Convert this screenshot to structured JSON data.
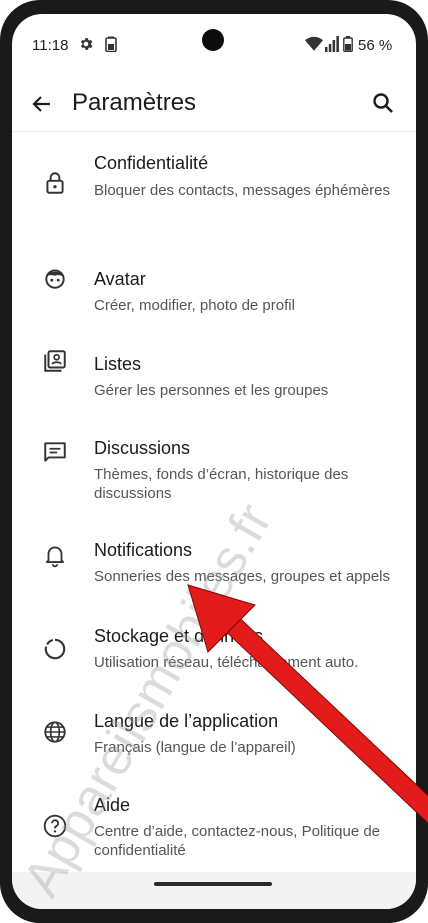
{
  "status_bar": {
    "time": "11:18",
    "battery_percent": "56 %"
  },
  "app_bar": {
    "title": "Paramètres"
  },
  "settings": [
    {
      "title": "Confidentialité",
      "subtitle": "Bloquer des contacts, messages éphémères",
      "icon": "lock-icon"
    },
    {
      "title": "Avatar",
      "subtitle": "Créer, modifier, photo de profil",
      "icon": "avatar-face-icon"
    },
    {
      "title": "Listes",
      "subtitle": "Gérer les personnes et les groupes",
      "icon": "contacts-list-icon"
    },
    {
      "title": "Discussions",
      "subtitle": "Thèmes, fonds d’écran, historique des discussions",
      "icon": "chat-icon"
    },
    {
      "title": "Notifications",
      "subtitle": "Sonneries des messages, groupes et appels",
      "icon": "bell-icon"
    },
    {
      "title": "Stockage et données",
      "subtitle": "Utilisation réseau, téléchargement auto.",
      "icon": "storage-circle-icon"
    },
    {
      "title": "Langue de l’application",
      "subtitle": "Français (langue de l’appareil)",
      "icon": "globe-icon"
    },
    {
      "title": "Aide",
      "subtitle": "Centre d’aide, contactez-nous, Politique de confidentialité",
      "icon": "help-icon"
    }
  ],
  "watermark": "Appareilsmobiles.fr",
  "colors": {
    "arrow": "#e31b1b",
    "text_primary": "#1b1b1b",
    "text_secondary": "#555555"
  }
}
